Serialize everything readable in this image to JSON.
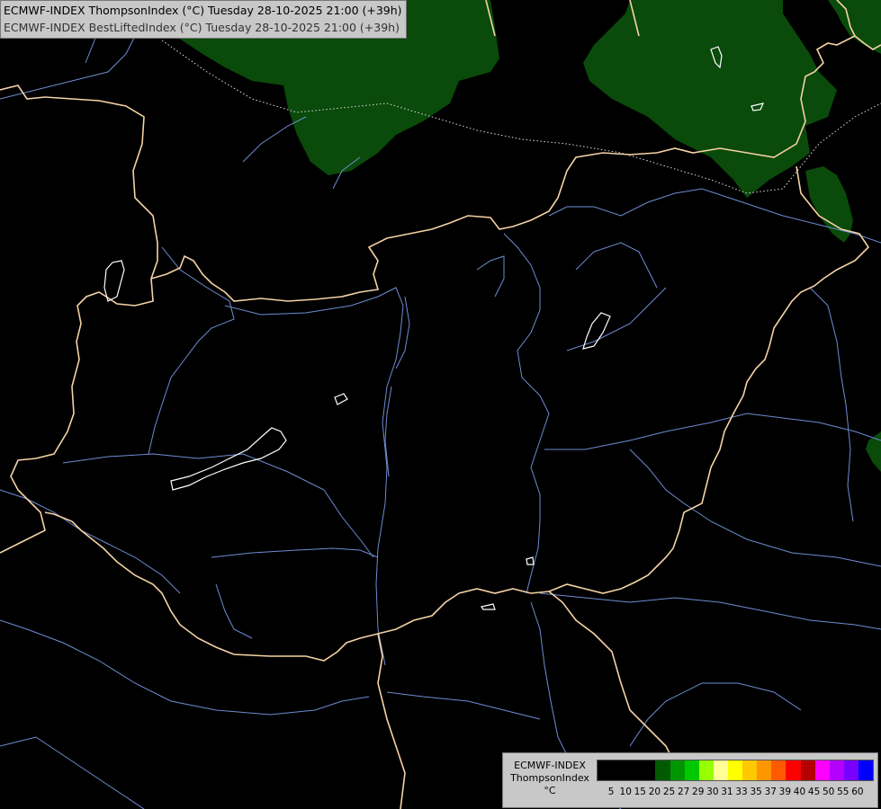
{
  "header": {
    "line1": "ECMWF-INDEX ThompsonIndex (°C) Tuesday 28-10-2025 21:00 (+39h)",
    "line2": "ECMWF-INDEX BestLiftedIndex (°C) Tuesday 28-10-2025 21:00 (+39h)"
  },
  "legend": {
    "title_line1": "ECMWF-INDEX",
    "title_line2": "ThompsonIndex",
    "unit": "°C",
    "ticks": [
      "5",
      "10",
      "15",
      "20",
      "25",
      "27",
      "29",
      "30",
      "31",
      "33",
      "35",
      "37",
      "39",
      "40",
      "45",
      "50",
      "55",
      "60"
    ],
    "colors": [
      "#000000",
      "#000000",
      "#000000",
      "#000000",
      "#005a00",
      "#009600",
      "#00c800",
      "#96ff00",
      "#ffff96",
      "#ffff00",
      "#ffc800",
      "#ff9600",
      "#ff5a00",
      "#ff0000",
      "#b40000",
      "#ff00ff",
      "#b400ff",
      "#7800ff",
      "#0000ff"
    ]
  },
  "colors": {
    "background": "#000000",
    "stability_area": "#0a4a0a",
    "border": "#f5d2a5",
    "river": "#6e8cd2",
    "lake_outline": "#ffffff",
    "dotted_line": "#dddddd"
  }
}
